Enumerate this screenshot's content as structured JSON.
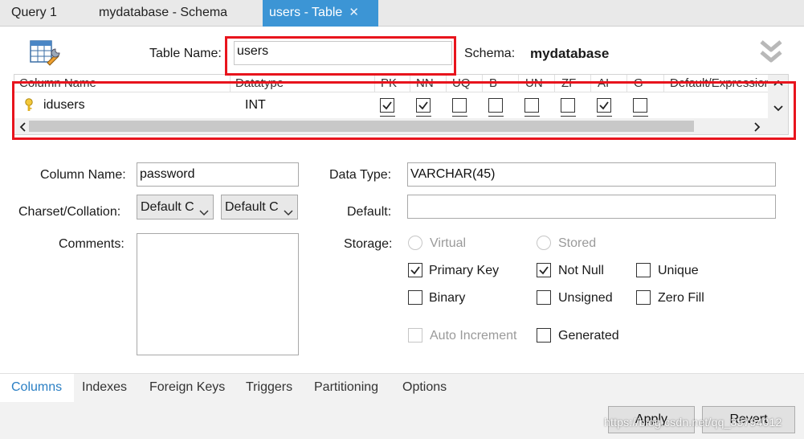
{
  "tabs": [
    {
      "label": "Query 1"
    },
    {
      "label": "mydatabase - Schema"
    },
    {
      "label": "users - Table",
      "close": "✕"
    }
  ],
  "header": {
    "table_name_label": "Table Name:",
    "table_name_value": "users",
    "schema_label": "Schema:",
    "schema_value": "mydatabase"
  },
  "grid": {
    "headers": [
      "Column Name",
      "Datatype",
      "PK",
      "NN",
      "UQ",
      "B",
      "UN",
      "ZF",
      "AI",
      "G",
      "Default/Expression"
    ],
    "rows": [
      {
        "name": "idusers",
        "datatype": "INT",
        "pk": true,
        "nn": true,
        "uq": false,
        "b": false,
        "un": false,
        "zf": false,
        "ai": true,
        "g": false
      }
    ]
  },
  "details": {
    "column_name_label": "Column Name:",
    "column_name_value": "password",
    "data_type_label": "Data Type:",
    "data_type_value": "VARCHAR(45)",
    "charset_label": "Charset/Collation:",
    "charset_value": "Default C",
    "collation_value": "Default C",
    "default_label": "Default:",
    "default_value": "",
    "comments_label": "Comments:",
    "storage_label": "Storage:",
    "virtual_label": "Virtual",
    "stored_label": "Stored",
    "primary_key_label": "Primary Key",
    "primary_key": true,
    "not_null_label": "Not Null",
    "not_null": true,
    "unique_label": "Unique",
    "unique": false,
    "binary_label": "Binary",
    "binary": false,
    "unsigned_label": "Unsigned",
    "unsigned": false,
    "zero_fill_label": "Zero Fill",
    "zero_fill": false,
    "auto_increment_label": "Auto Increment",
    "auto_increment": false,
    "generated_label": "Generated",
    "generated": false
  },
  "bottom_tabs": [
    {
      "label": "Columns",
      "active": true
    },
    {
      "label": "Indexes"
    },
    {
      "label": "Foreign Keys"
    },
    {
      "label": "Triggers"
    },
    {
      "label": "Partitioning"
    },
    {
      "label": "Options"
    }
  ],
  "buttons": {
    "apply": "Apply",
    "revert": "Revert"
  },
  "watermark": "https://blog.csdn.net/qq_35794012",
  "colors": {
    "accent": "#3c95d5",
    "highlight": "#e8141d",
    "active_tab_text": "#2a7fc4"
  }
}
